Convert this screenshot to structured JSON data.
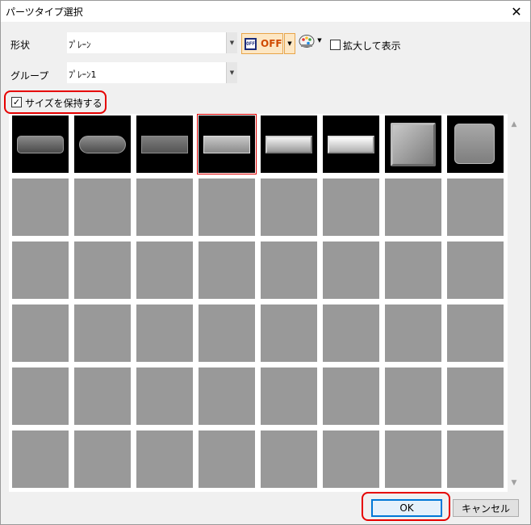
{
  "dialog": {
    "title": "パーツタイプ選択",
    "close_glyph": "✕"
  },
  "shape_row": {
    "label": "形状",
    "value": "ﾌﾟﾚｰﾝ"
  },
  "group_row": {
    "label": "グループ",
    "value": "ﾌﾟﾚｰﾝ1"
  },
  "off_button": {
    "icon_text": "OFF",
    "label": "OFF"
  },
  "enlarge": {
    "label": "拡大して表示",
    "checked": false
  },
  "keep_size": {
    "label": "サイズを保持する",
    "checked": true,
    "check_glyph": "✓"
  },
  "grid": {
    "rows": 6,
    "cols": 8,
    "selected_index": 3,
    "parts": [
      {
        "name": "rounded-dark"
      },
      {
        "name": "pill-dark"
      },
      {
        "name": "flat-dark"
      },
      {
        "name": "flat-light"
      },
      {
        "name": "bevel-light"
      },
      {
        "name": "bevel-bright"
      },
      {
        "name": "square-bevel"
      },
      {
        "name": "square-rounded"
      }
    ]
  },
  "scroll": {
    "up": "▲",
    "down": "▼"
  },
  "buttons": {
    "ok": "OK",
    "cancel": "キャンセル"
  },
  "arrow_glyph": "▼"
}
